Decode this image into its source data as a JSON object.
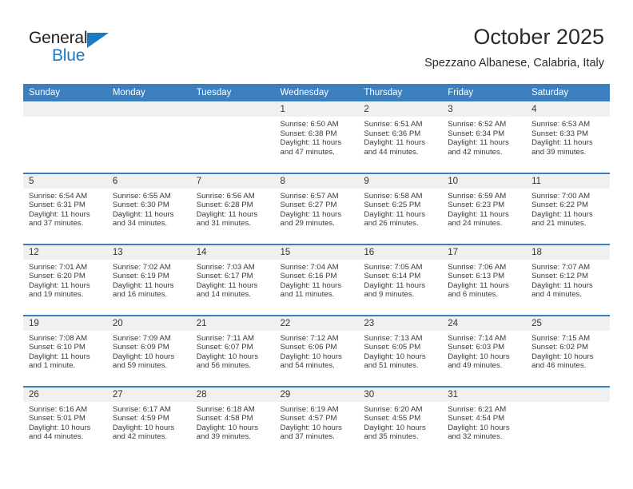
{
  "brand": {
    "name_top": "General",
    "name_bottom": "Blue",
    "triangle_color": "#1a7bc4",
    "text_color": "#231f20"
  },
  "header": {
    "title": "October 2025",
    "subtitle": "Spezzano Albanese, Calabria, Italy",
    "accent_color": "#3c7fbf",
    "daynum_bg": "#f0f0f0"
  },
  "weekday_headers": [
    "Sunday",
    "Monday",
    "Tuesday",
    "Wednesday",
    "Thursday",
    "Friday",
    "Saturday"
  ],
  "labels": {
    "sunrise_prefix": "Sunrise:",
    "sunset_prefix": "Sunset:",
    "daylight_prefix": "Daylight:"
  },
  "weeks": [
    [
      {
        "day": "",
        "sunrise": "",
        "sunset": "",
        "daylight_line1": "",
        "daylight_line2": "",
        "empty": true
      },
      {
        "day": "",
        "sunrise": "",
        "sunset": "",
        "daylight_line1": "",
        "daylight_line2": "",
        "empty": true
      },
      {
        "day": "",
        "sunrise": "",
        "sunset": "",
        "daylight_line1": "",
        "daylight_line2": "",
        "empty": true
      },
      {
        "day": "1",
        "sunrise": "Sunrise: 6:50 AM",
        "sunset": "Sunset: 6:38 PM",
        "daylight_line1": "Daylight: 11 hours",
        "daylight_line2": "and 47 minutes.",
        "empty": false
      },
      {
        "day": "2",
        "sunrise": "Sunrise: 6:51 AM",
        "sunset": "Sunset: 6:36 PM",
        "daylight_line1": "Daylight: 11 hours",
        "daylight_line2": "and 44 minutes.",
        "empty": false
      },
      {
        "day": "3",
        "sunrise": "Sunrise: 6:52 AM",
        "sunset": "Sunset: 6:34 PM",
        "daylight_line1": "Daylight: 11 hours",
        "daylight_line2": "and 42 minutes.",
        "empty": false
      },
      {
        "day": "4",
        "sunrise": "Sunrise: 6:53 AM",
        "sunset": "Sunset: 6:33 PM",
        "daylight_line1": "Daylight: 11 hours",
        "daylight_line2": "and 39 minutes.",
        "empty": false
      }
    ],
    [
      {
        "day": "5",
        "sunrise": "Sunrise: 6:54 AM",
        "sunset": "Sunset: 6:31 PM",
        "daylight_line1": "Daylight: 11 hours",
        "daylight_line2": "and 37 minutes.",
        "empty": false
      },
      {
        "day": "6",
        "sunrise": "Sunrise: 6:55 AM",
        "sunset": "Sunset: 6:30 PM",
        "daylight_line1": "Daylight: 11 hours",
        "daylight_line2": "and 34 minutes.",
        "empty": false
      },
      {
        "day": "7",
        "sunrise": "Sunrise: 6:56 AM",
        "sunset": "Sunset: 6:28 PM",
        "daylight_line1": "Daylight: 11 hours",
        "daylight_line2": "and 31 minutes.",
        "empty": false
      },
      {
        "day": "8",
        "sunrise": "Sunrise: 6:57 AM",
        "sunset": "Sunset: 6:27 PM",
        "daylight_line1": "Daylight: 11 hours",
        "daylight_line2": "and 29 minutes.",
        "empty": false
      },
      {
        "day": "9",
        "sunrise": "Sunrise: 6:58 AM",
        "sunset": "Sunset: 6:25 PM",
        "daylight_line1": "Daylight: 11 hours",
        "daylight_line2": "and 26 minutes.",
        "empty": false
      },
      {
        "day": "10",
        "sunrise": "Sunrise: 6:59 AM",
        "sunset": "Sunset: 6:23 PM",
        "daylight_line1": "Daylight: 11 hours",
        "daylight_line2": "and 24 minutes.",
        "empty": false
      },
      {
        "day": "11",
        "sunrise": "Sunrise: 7:00 AM",
        "sunset": "Sunset: 6:22 PM",
        "daylight_line1": "Daylight: 11 hours",
        "daylight_line2": "and 21 minutes.",
        "empty": false
      }
    ],
    [
      {
        "day": "12",
        "sunrise": "Sunrise: 7:01 AM",
        "sunset": "Sunset: 6:20 PM",
        "daylight_line1": "Daylight: 11 hours",
        "daylight_line2": "and 19 minutes.",
        "empty": false
      },
      {
        "day": "13",
        "sunrise": "Sunrise: 7:02 AM",
        "sunset": "Sunset: 6:19 PM",
        "daylight_line1": "Daylight: 11 hours",
        "daylight_line2": "and 16 minutes.",
        "empty": false
      },
      {
        "day": "14",
        "sunrise": "Sunrise: 7:03 AM",
        "sunset": "Sunset: 6:17 PM",
        "daylight_line1": "Daylight: 11 hours",
        "daylight_line2": "and 14 minutes.",
        "empty": false
      },
      {
        "day": "15",
        "sunrise": "Sunrise: 7:04 AM",
        "sunset": "Sunset: 6:16 PM",
        "daylight_line1": "Daylight: 11 hours",
        "daylight_line2": "and 11 minutes.",
        "empty": false
      },
      {
        "day": "16",
        "sunrise": "Sunrise: 7:05 AM",
        "sunset": "Sunset: 6:14 PM",
        "daylight_line1": "Daylight: 11 hours",
        "daylight_line2": "and 9 minutes.",
        "empty": false
      },
      {
        "day": "17",
        "sunrise": "Sunrise: 7:06 AM",
        "sunset": "Sunset: 6:13 PM",
        "daylight_line1": "Daylight: 11 hours",
        "daylight_line2": "and 6 minutes.",
        "empty": false
      },
      {
        "day": "18",
        "sunrise": "Sunrise: 7:07 AM",
        "sunset": "Sunset: 6:12 PM",
        "daylight_line1": "Daylight: 11 hours",
        "daylight_line2": "and 4 minutes.",
        "empty": false
      }
    ],
    [
      {
        "day": "19",
        "sunrise": "Sunrise: 7:08 AM",
        "sunset": "Sunset: 6:10 PM",
        "daylight_line1": "Daylight: 11 hours",
        "daylight_line2": "and 1 minute.",
        "empty": false
      },
      {
        "day": "20",
        "sunrise": "Sunrise: 7:09 AM",
        "sunset": "Sunset: 6:09 PM",
        "daylight_line1": "Daylight: 10 hours",
        "daylight_line2": "and 59 minutes.",
        "empty": false
      },
      {
        "day": "21",
        "sunrise": "Sunrise: 7:11 AM",
        "sunset": "Sunset: 6:07 PM",
        "daylight_line1": "Daylight: 10 hours",
        "daylight_line2": "and 56 minutes.",
        "empty": false
      },
      {
        "day": "22",
        "sunrise": "Sunrise: 7:12 AM",
        "sunset": "Sunset: 6:06 PM",
        "daylight_line1": "Daylight: 10 hours",
        "daylight_line2": "and 54 minutes.",
        "empty": false
      },
      {
        "day": "23",
        "sunrise": "Sunrise: 7:13 AM",
        "sunset": "Sunset: 6:05 PM",
        "daylight_line1": "Daylight: 10 hours",
        "daylight_line2": "and 51 minutes.",
        "empty": false
      },
      {
        "day": "24",
        "sunrise": "Sunrise: 7:14 AM",
        "sunset": "Sunset: 6:03 PM",
        "daylight_line1": "Daylight: 10 hours",
        "daylight_line2": "and 49 minutes.",
        "empty": false
      },
      {
        "day": "25",
        "sunrise": "Sunrise: 7:15 AM",
        "sunset": "Sunset: 6:02 PM",
        "daylight_line1": "Daylight: 10 hours",
        "daylight_line2": "and 46 minutes.",
        "empty": false
      }
    ],
    [
      {
        "day": "26",
        "sunrise": "Sunrise: 6:16 AM",
        "sunset": "Sunset: 5:01 PM",
        "daylight_line1": "Daylight: 10 hours",
        "daylight_line2": "and 44 minutes.",
        "empty": false
      },
      {
        "day": "27",
        "sunrise": "Sunrise: 6:17 AM",
        "sunset": "Sunset: 4:59 PM",
        "daylight_line1": "Daylight: 10 hours",
        "daylight_line2": "and 42 minutes.",
        "empty": false
      },
      {
        "day": "28",
        "sunrise": "Sunrise: 6:18 AM",
        "sunset": "Sunset: 4:58 PM",
        "daylight_line1": "Daylight: 10 hours",
        "daylight_line2": "and 39 minutes.",
        "empty": false
      },
      {
        "day": "29",
        "sunrise": "Sunrise: 6:19 AM",
        "sunset": "Sunset: 4:57 PM",
        "daylight_line1": "Daylight: 10 hours",
        "daylight_line2": "and 37 minutes.",
        "empty": false
      },
      {
        "day": "30",
        "sunrise": "Sunrise: 6:20 AM",
        "sunset": "Sunset: 4:55 PM",
        "daylight_line1": "Daylight: 10 hours",
        "daylight_line2": "and 35 minutes.",
        "empty": false
      },
      {
        "day": "31",
        "sunrise": "Sunrise: 6:21 AM",
        "sunset": "Sunset: 4:54 PM",
        "daylight_line1": "Daylight: 10 hours",
        "daylight_line2": "and 32 minutes.",
        "empty": false
      },
      {
        "day": "",
        "sunrise": "",
        "sunset": "",
        "daylight_line1": "",
        "daylight_line2": "",
        "empty": true
      }
    ]
  ]
}
